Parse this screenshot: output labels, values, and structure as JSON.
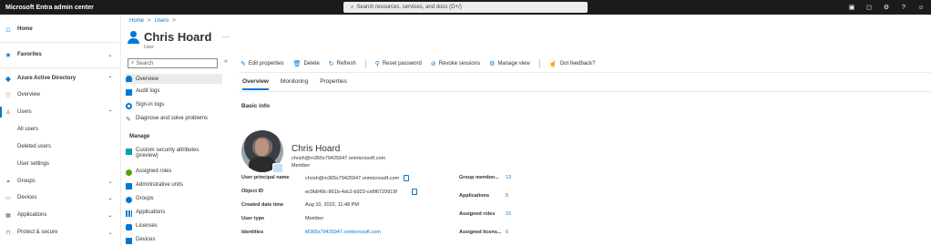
{
  "topbar": {
    "brand": "Microsoft Entra admin center",
    "search_placeholder": "Search resources, services, and docs (G+/)"
  },
  "leftnav": {
    "items": [
      {
        "label": "Home",
        "icon": "home-icon",
        "color": "#0078d4"
      },
      {
        "label": "Favorites",
        "icon": "star-icon",
        "color": "#0078d4"
      },
      {
        "label": "Azure Active Directory",
        "icon": "azure-ad-icon",
        "color": "#0078d4"
      },
      {
        "label": "Overview",
        "icon": "info-icon",
        "color": "#605e5c"
      },
      {
        "label": "Users",
        "icon": "user-icon",
        "color": "#605e5c"
      },
      {
        "label": "All users"
      },
      {
        "label": "Deleted users"
      },
      {
        "label": "User settings"
      },
      {
        "label": "Groups",
        "icon": "groups-icon",
        "color": "#605e5c"
      },
      {
        "label": "Devices",
        "icon": "devices-icon",
        "color": "#605e5c"
      },
      {
        "label": "Applications",
        "icon": "apps-icon",
        "color": "#605e5c"
      },
      {
        "label": "Protect & secure",
        "icon": "lock-icon",
        "color": "#605e5c"
      }
    ]
  },
  "breadcrumb": {
    "home": "Home",
    "sep": ">",
    "users": "Users"
  },
  "header": {
    "title": "Chris Hoard",
    "subtitle": "User",
    "more": "···"
  },
  "sidenav": {
    "search_placeholder": "Search",
    "collapse": "«",
    "manage_heading": "Manage",
    "items_top": [
      {
        "label": "Overview",
        "icon_color": "#0078d4"
      },
      {
        "label": "Audit logs",
        "icon_color": "#0078d4"
      },
      {
        "label": "Sign-in logs",
        "icon_color": "#0078d4"
      },
      {
        "label": "Diagnose and solve problems",
        "icon_color": "#605e5c"
      }
    ],
    "items_manage": [
      {
        "label": "Custom security attributes (preview)",
        "icon_color": "#00a2ad"
      },
      {
        "label": "Assigned roles",
        "icon_color": "#57a300"
      },
      {
        "label": "Administrative units",
        "icon_color": "#0078d4"
      },
      {
        "label": "Groups",
        "icon_color": "#0078d4"
      },
      {
        "label": "Applications",
        "icon_color": "#0078d4"
      },
      {
        "label": "Licenses",
        "icon_color": "#0078d4"
      },
      {
        "label": "Devices",
        "icon_color": "#0078d4"
      }
    ]
  },
  "commands": {
    "edit": "Edit properties",
    "delete": "Delete",
    "refresh": "Refresh",
    "reset": "Reset password",
    "revoke": "Revoke sessions",
    "manage_view": "Manage view",
    "feedback": "Got feedback?"
  },
  "tabs": {
    "overview": "Overview",
    "monitoring": "Monitoring",
    "properties": "Properties"
  },
  "basic_info": {
    "heading": "Basic info",
    "name": "Chris Hoard",
    "email": "chrish@m365x79425947.onmicrosoft.com",
    "type": "Member"
  },
  "props": [
    {
      "label": "User principal name",
      "value": "chrish@m365x79425947.onmicrosoft.com"
    },
    {
      "label": "Object ID",
      "value": "ec9b849c-861b-4dc2-b923-ce8f6729919f"
    },
    {
      "label": "Created date time",
      "value": "Aug 10, 2022, 11:48 PM"
    },
    {
      "label": "User type",
      "value": "Member"
    },
    {
      "label": "Identities",
      "value": "M365x79425947.onmicrosoft.com"
    }
  ],
  "stats": [
    {
      "label": "Group member...",
      "value": "13"
    },
    {
      "label": "Applications",
      "value": "5"
    },
    {
      "label": "Assigned roles",
      "value": "15"
    },
    {
      "label": "Assigned licens...",
      "value": "6"
    }
  ]
}
